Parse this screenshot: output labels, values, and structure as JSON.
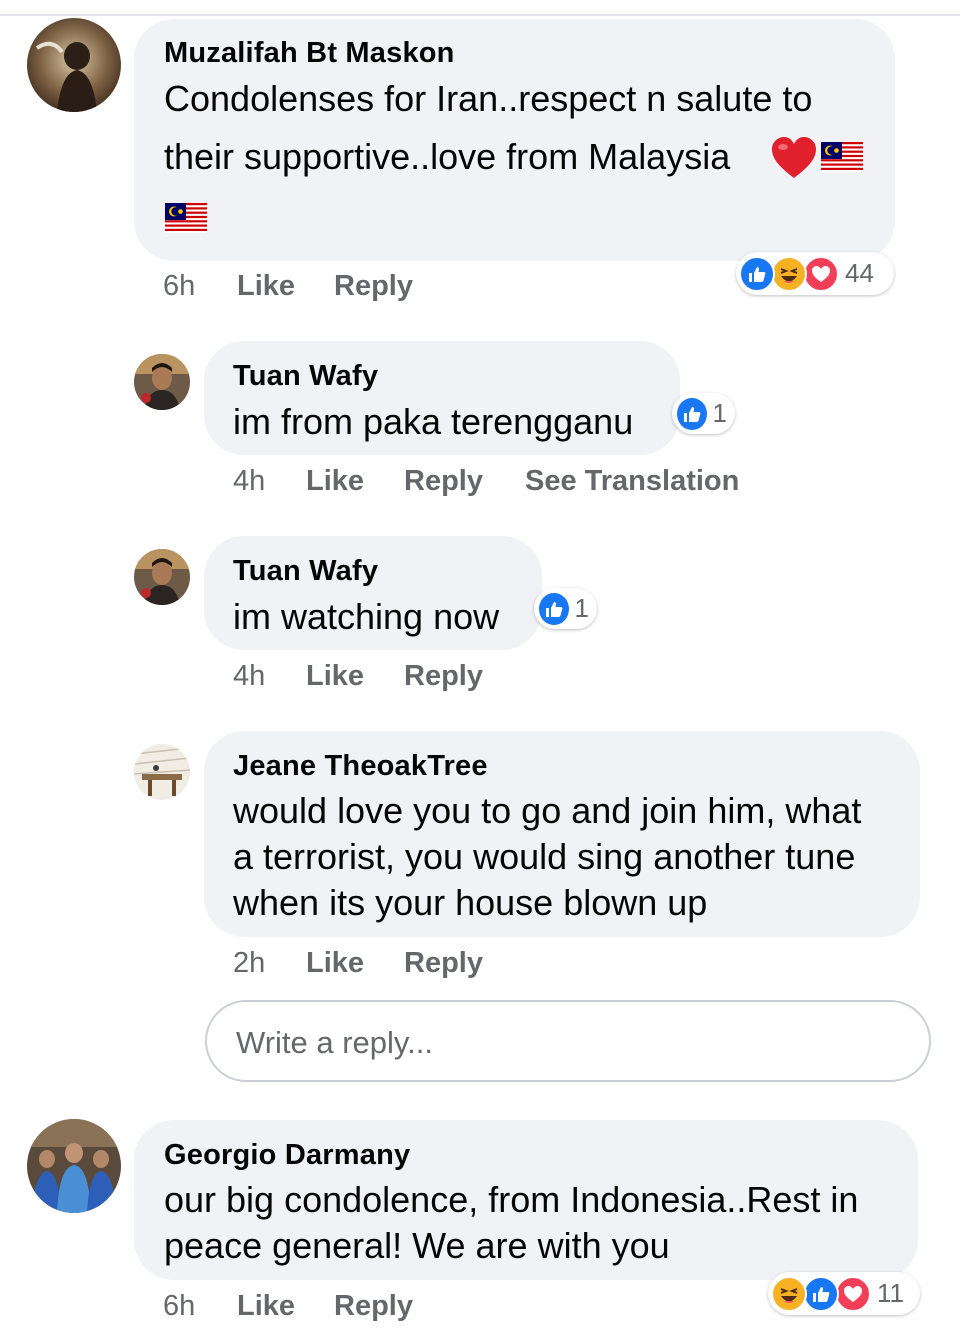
{
  "comments": [
    {
      "author": "Muzalifah Bt Maskon",
      "lines": [
        "Condolenses for Iran..respect n salute to",
        "their supportive..love from Malaysia"
      ],
      "emoji": [
        "heart-emoji",
        "malaysia-flag",
        "malaysia-flag"
      ],
      "time": "6h",
      "like_label": "Like",
      "reply_label": "Reply",
      "reactions": [
        "like",
        "haha",
        "love"
      ],
      "reaction_count": "44"
    },
    {
      "author": "Tuan Wafy",
      "lines": [
        "im from paka terengganu"
      ],
      "time": "4h",
      "like_label": "Like",
      "reply_label": "Reply",
      "translate_label": "See Translation",
      "reactions": [
        "like"
      ],
      "reaction_count": "1"
    },
    {
      "author": "Tuan Wafy",
      "lines": [
        "im watching now"
      ],
      "time": "4h",
      "like_label": "Like",
      "reply_label": "Reply",
      "reactions": [
        "like"
      ],
      "reaction_count": "1"
    },
    {
      "author": "Jeane TheoakTree",
      "lines": [
        "would love you to go and join him, what",
        "a terrorist, you would sing another tune",
        "when its your house blown up"
      ],
      "time": "2h",
      "like_label": "Like",
      "reply_label": "Reply"
    },
    {
      "author": "Georgio Darmany",
      "lines": [
        "our big condolence, from Indonesia..Rest in",
        "peace general! We are with you"
      ],
      "time": "6h",
      "like_label": "Like",
      "reply_label": "Reply",
      "reactions": [
        "haha",
        "like",
        "love"
      ],
      "reaction_count": "11"
    }
  ],
  "reply_input": {
    "placeholder": "Write a reply...",
    "value": ""
  },
  "colors": {
    "bubble": "#f0f2f5",
    "meta_text": "#65676b",
    "like_blue": "#1877f2",
    "love_red": "#f33e58",
    "haha_yellow": "#f7b125"
  }
}
